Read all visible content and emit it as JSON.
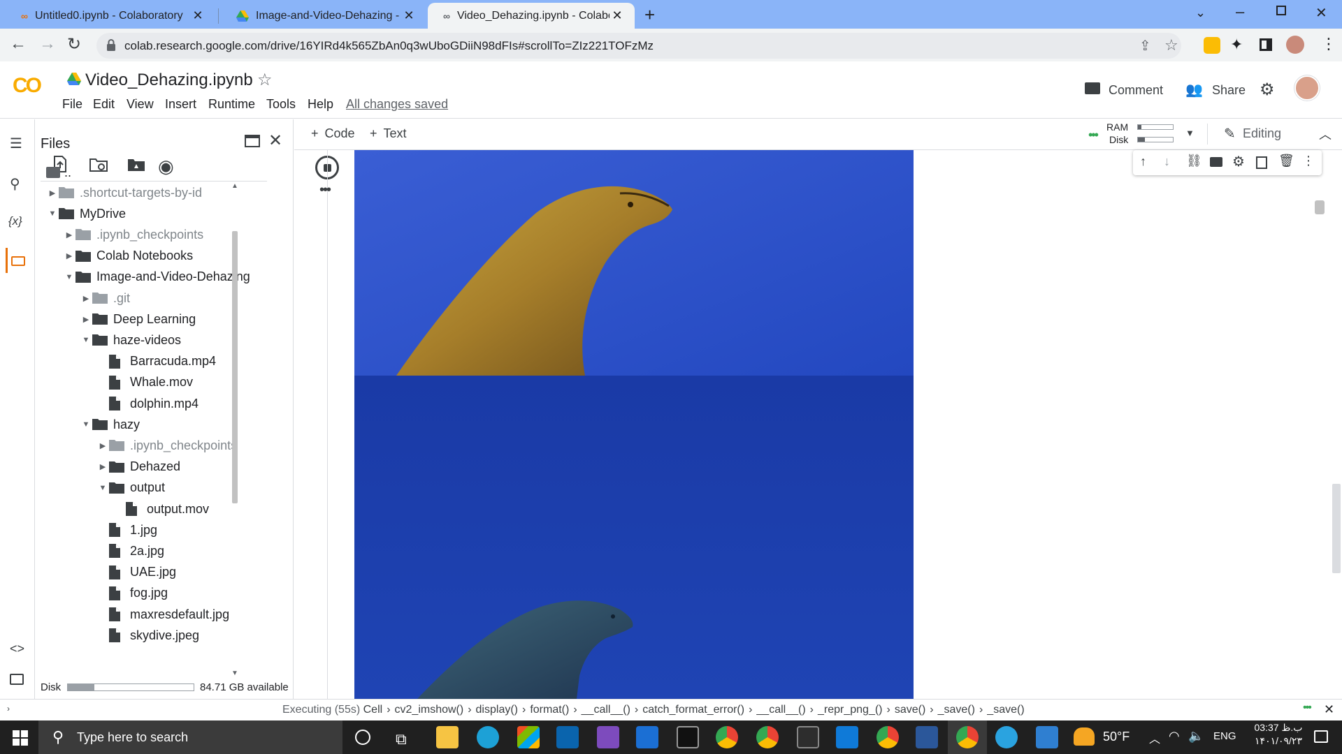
{
  "browser": {
    "tabs": [
      {
        "title": "Untitled0.ipynb - Colaboratory",
        "active": false
      },
      {
        "title": "Image-and-Video-Dehazing - Go",
        "active": false
      },
      {
        "title": "Video_Dehazing.ipynb - Colabora",
        "active": true
      }
    ],
    "url": "colab.research.google.com/drive/16YIRd4k565ZbAn0q3wUboGDiiN98dFIs#scrollTo=ZIz221TOFzMz"
  },
  "colab": {
    "logo": "CO",
    "notebook_title": "Video_Dehazing.ipynb",
    "menu": [
      "File",
      "Edit",
      "View",
      "Insert",
      "Runtime",
      "Tools",
      "Help"
    ],
    "save_status": "All changes saved",
    "comment_label": "Comment",
    "share_label": "Share"
  },
  "files_panel": {
    "title": "Files",
    "parent": "..",
    "tree": [
      {
        "name": ".shortcut-targets-by-id",
        "type": "folder",
        "depth": 0,
        "expanded": false,
        "dim": true
      },
      {
        "name": "MyDrive",
        "type": "folder",
        "depth": 0,
        "expanded": true,
        "dim": false
      },
      {
        "name": ".ipynb_checkpoints",
        "type": "folder",
        "depth": 1,
        "expanded": false,
        "dim": true
      },
      {
        "name": "Colab Notebooks",
        "type": "folder",
        "depth": 1,
        "expanded": false,
        "dim": false
      },
      {
        "name": "Image-and-Video-Dehazing",
        "type": "folder",
        "depth": 1,
        "expanded": true,
        "dim": false
      },
      {
        "name": ".git",
        "type": "folder",
        "depth": 2,
        "expanded": false,
        "dim": true
      },
      {
        "name": "Deep Learning",
        "type": "folder",
        "depth": 2,
        "expanded": false,
        "dim": false
      },
      {
        "name": "haze-videos",
        "type": "folder",
        "depth": 2,
        "expanded": true,
        "dim": false
      },
      {
        "name": "Barracuda.mp4",
        "type": "file",
        "depth": 3,
        "dim": false
      },
      {
        "name": "Whale.mov",
        "type": "file",
        "depth": 3,
        "dim": false
      },
      {
        "name": "dolphin.mp4",
        "type": "file",
        "depth": 3,
        "dim": false
      },
      {
        "name": "hazy",
        "type": "folder",
        "depth": 2,
        "expanded": true,
        "dim": false
      },
      {
        "name": ".ipynb_checkpoints",
        "type": "folder",
        "depth": 3,
        "expanded": false,
        "dim": true
      },
      {
        "name": "Dehazed",
        "type": "folder",
        "depth": 3,
        "expanded": false,
        "dim": false
      },
      {
        "name": "output",
        "type": "folder",
        "depth": 3,
        "expanded": true,
        "dim": false
      },
      {
        "name": "output.mov",
        "type": "file",
        "depth": 4,
        "dim": false
      },
      {
        "name": "1.jpg",
        "type": "file",
        "depth": 3,
        "dim": false
      },
      {
        "name": "2a.jpg",
        "type": "file",
        "depth": 3,
        "dim": false
      },
      {
        "name": "UAE.jpg",
        "type": "file",
        "depth": 3,
        "dim": false
      },
      {
        "name": "fog.jpg",
        "type": "file",
        "depth": 3,
        "dim": false
      },
      {
        "name": "maxresdefault.jpg",
        "type": "file",
        "depth": 3,
        "dim": false
      },
      {
        "name": "skydive.jpeg",
        "type": "file",
        "depth": 3,
        "dim": false
      }
    ],
    "disk_label": "Disk",
    "disk_available": "84.71 GB available",
    "disk_used_fraction": 0.21
  },
  "notebook": {
    "add_code": "Code",
    "add_text": "Text",
    "ram_label": "RAM",
    "disk_label": "Disk",
    "ram_used_fraction": 0.1,
    "disk_used_fraction": 0.2,
    "mode_label": "Editing"
  },
  "status_bar": {
    "executing": "Executing (55s)",
    "stack": [
      "Cell",
      "cv2_imshow()",
      "display()",
      "format()",
      "__call__()",
      "catch_format_error()",
      "__call__()",
      "_repr_png_()",
      "save()",
      "_save()",
      "_save()"
    ]
  },
  "taskbar": {
    "search_placeholder": "Type here to search",
    "weather": "50°F",
    "language": "ENG",
    "time": "03:37 ب.ظ",
    "date": "۱۴۰۱/۰۹/۲۳"
  },
  "colors": {
    "tabstrip": "#8ab4f8",
    "colab_orange": "#f9ab00",
    "colab_orange_dark": "#e8710a",
    "underwater_top": "#2e55c8",
    "underwater_bottom": "#1d3fa8"
  }
}
